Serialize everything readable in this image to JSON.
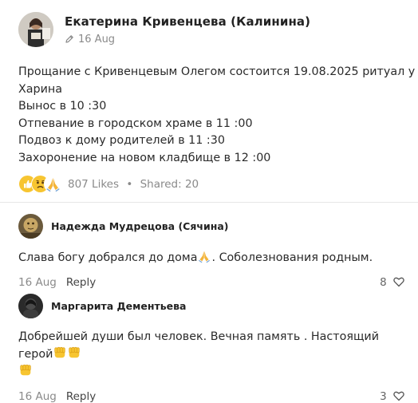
{
  "post": {
    "author": "Екатерина Кривенцева (Калинина)",
    "date": "16 Aug",
    "lines": [
      "Прощание с Кривенцевым Олегом состоится 19.08.2025 ритуал у",
      "Харина",
      "Вынос в 10 :30",
      "Отпевание в городском храме в 11 :00",
      "Подвоз к дому родителей в 11 :30",
      "Захоронение на новом кладбище в 12 :00"
    ],
    "reactions": [
      "like",
      "sad",
      "pray"
    ],
    "likes": "807 Likes",
    "separator": "•",
    "shared": "Shared: 20"
  },
  "comments": [
    {
      "author": "Надежда Мудрецова (Сячина)",
      "text": "Слава богу добрался до дома",
      "text_after": ". Соболезнования родным.",
      "date": "16 Aug",
      "reply": "Reply",
      "likes": "8"
    },
    {
      "author": "Маргарита Дементьева",
      "text": "Добрейшей души был человек. Вечная память . Настоящий герой",
      "date": "16 Aug",
      "reply": "Reply",
      "likes": "3"
    }
  ],
  "colors": {
    "text": "#2a2a2a",
    "muted": "#8a8a8a",
    "accent_yellow": "#f7c531"
  }
}
